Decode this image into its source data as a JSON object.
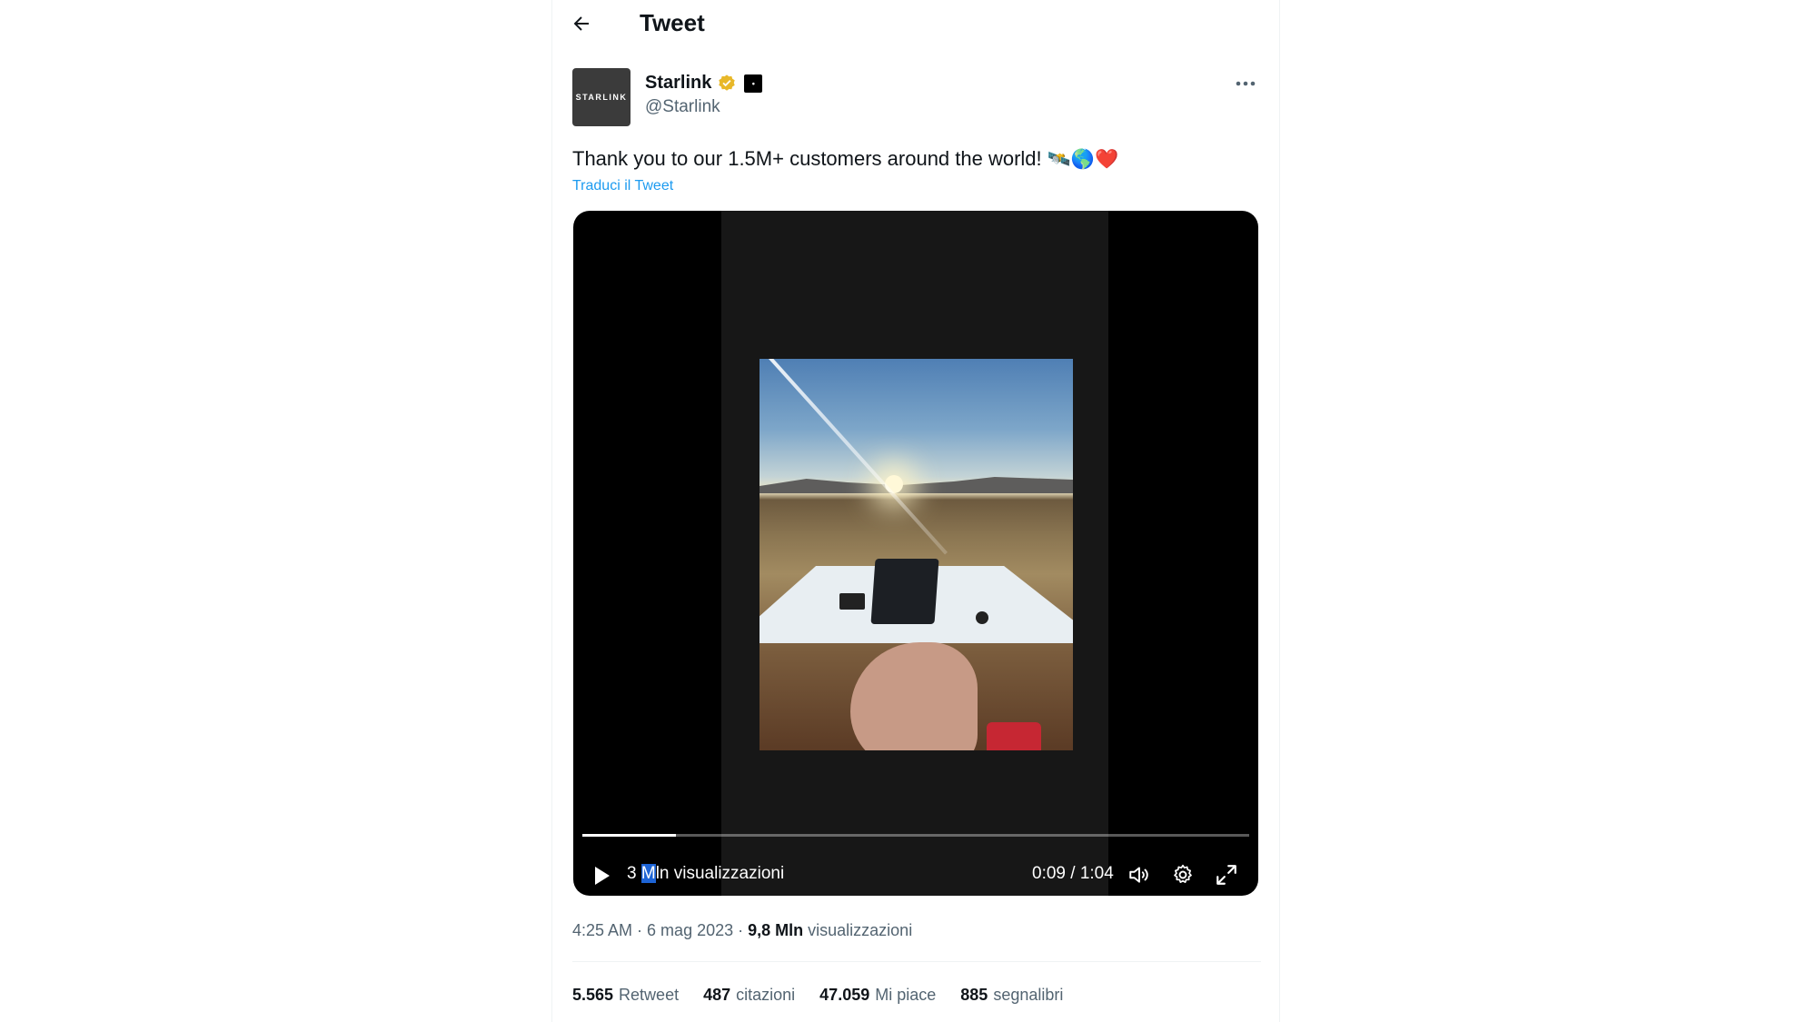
{
  "header": {
    "title": "Tweet",
    "back_icon": "arrow-left-icon"
  },
  "author": {
    "name": "Starlink",
    "handle": "@Starlink",
    "avatar_text": "STARLINK",
    "verified_color": "#e8b829"
  },
  "tweet": {
    "text": "Thank you to our 1.5M+ customers around the world!",
    "emojis": "🛰️🌎❤️",
    "translate_label": "Traduci il Tweet"
  },
  "video": {
    "views_prefix": "3 ",
    "views_highlight": "M",
    "views_suffix": "ln visualizzazioni",
    "current_time": "0:09",
    "separator": " / ",
    "duration": "1:04",
    "progress": 0.14
  },
  "meta": {
    "time": "4:25 AM",
    "dot1": " · ",
    "date": "6 mag 2023",
    "dot2": " · ",
    "views_count": "9,8 Mln",
    "views_label": " visualizzazioni"
  },
  "stats": [
    {
      "count": "5.565",
      "label": "Retweet"
    },
    {
      "count": "487",
      "label": "citazioni"
    },
    {
      "count": "47.059",
      "label": "Mi piace"
    },
    {
      "count": "885",
      "label": "segnalibri"
    }
  ],
  "colors": {
    "accent": "#1d9bf0",
    "muted": "#536471",
    "text": "#0f1419"
  }
}
